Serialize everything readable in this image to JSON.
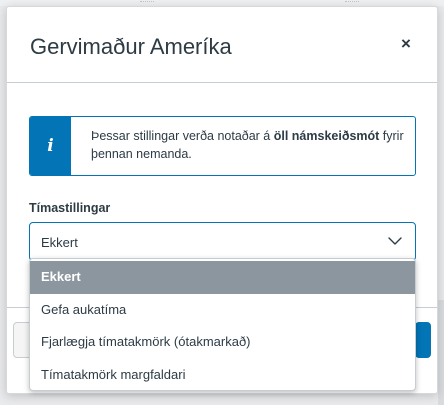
{
  "modal": {
    "title": "Gervimaður Ameríka",
    "close_symbol": "×",
    "close_icon": "close-icon"
  },
  "info_alert": {
    "icon": "info-icon",
    "icon_glyph": "i",
    "text_before": "Þessar stillingar verða notaðar á ",
    "text_bold": "öll námskeiðsmót",
    "text_after": " fyrir þennan nemanda."
  },
  "time_settings": {
    "label": "Tímastillingar",
    "selected_value": "Ekkert",
    "options": [
      "Ekkert",
      "Gefa aukatíma",
      "Fjarlægja tímatakmörk (ótakmarkað)",
      "Tímatakmörk margfaldari"
    ]
  },
  "colors": {
    "accent": "#0374b5",
    "selected_option_bg": "#8b969e",
    "text": "#2d3b45"
  }
}
